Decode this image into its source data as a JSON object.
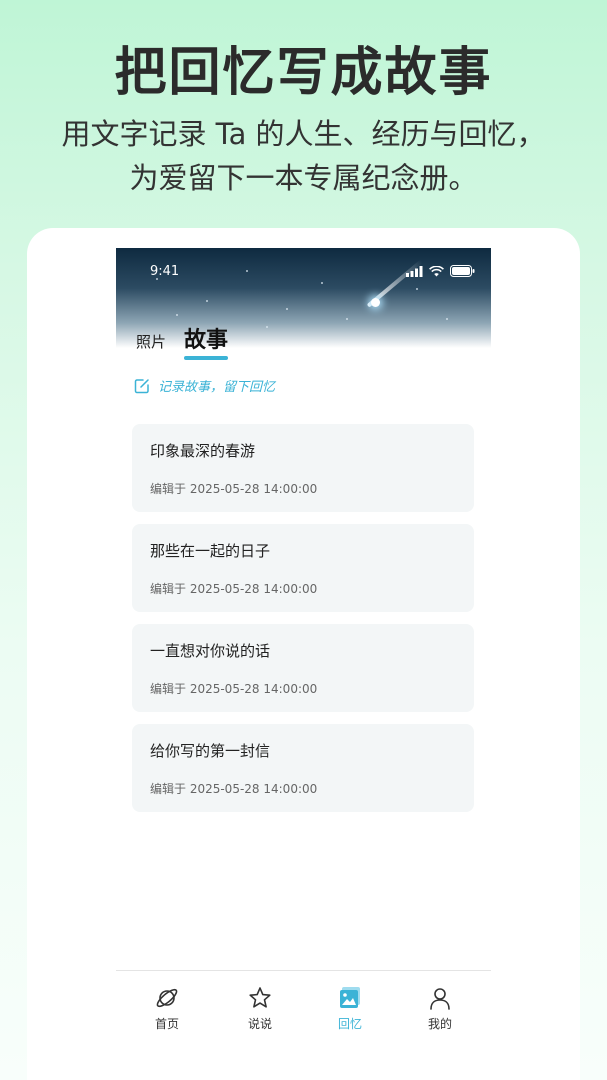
{
  "promo": {
    "title": "把回忆写成故事",
    "subtitle_line1": "用文字记录 Ta 的人生、经历与回忆，",
    "subtitle_line2": "为爱留下一本专属纪念册。"
  },
  "status_bar": {
    "time": "9:41"
  },
  "tabs": [
    {
      "label": "照片",
      "active": false
    },
    {
      "label": "故事",
      "active": true
    }
  ],
  "prompt": {
    "label": "记录故事，留下回忆",
    "icon": "edit-icon"
  },
  "stories": [
    {
      "title": "印象最深的春游",
      "edited": "编辑于 2025-05-28 14:00:00"
    },
    {
      "title": "那些在一起的日子",
      "edited": "编辑于 2025-05-28 14:00:00"
    },
    {
      "title": "一直想对你说的话",
      "edited": "编辑于 2025-05-28 14:00:00"
    },
    {
      "title": "给你写的第一封信",
      "edited": "编辑于 2025-05-28 14:00:00"
    }
  ],
  "bottom_nav": [
    {
      "label": "首页",
      "icon": "planet-icon",
      "active": false
    },
    {
      "label": "说说",
      "icon": "star-icon",
      "active": false
    },
    {
      "label": "回忆",
      "icon": "photo-album-icon",
      "active": true
    },
    {
      "label": "我的",
      "icon": "person-icon",
      "active": false
    }
  ],
  "colors": {
    "accent": "#3bb3d6",
    "background_top": "#bff5d6",
    "card_bg": "#f3f6f7"
  }
}
